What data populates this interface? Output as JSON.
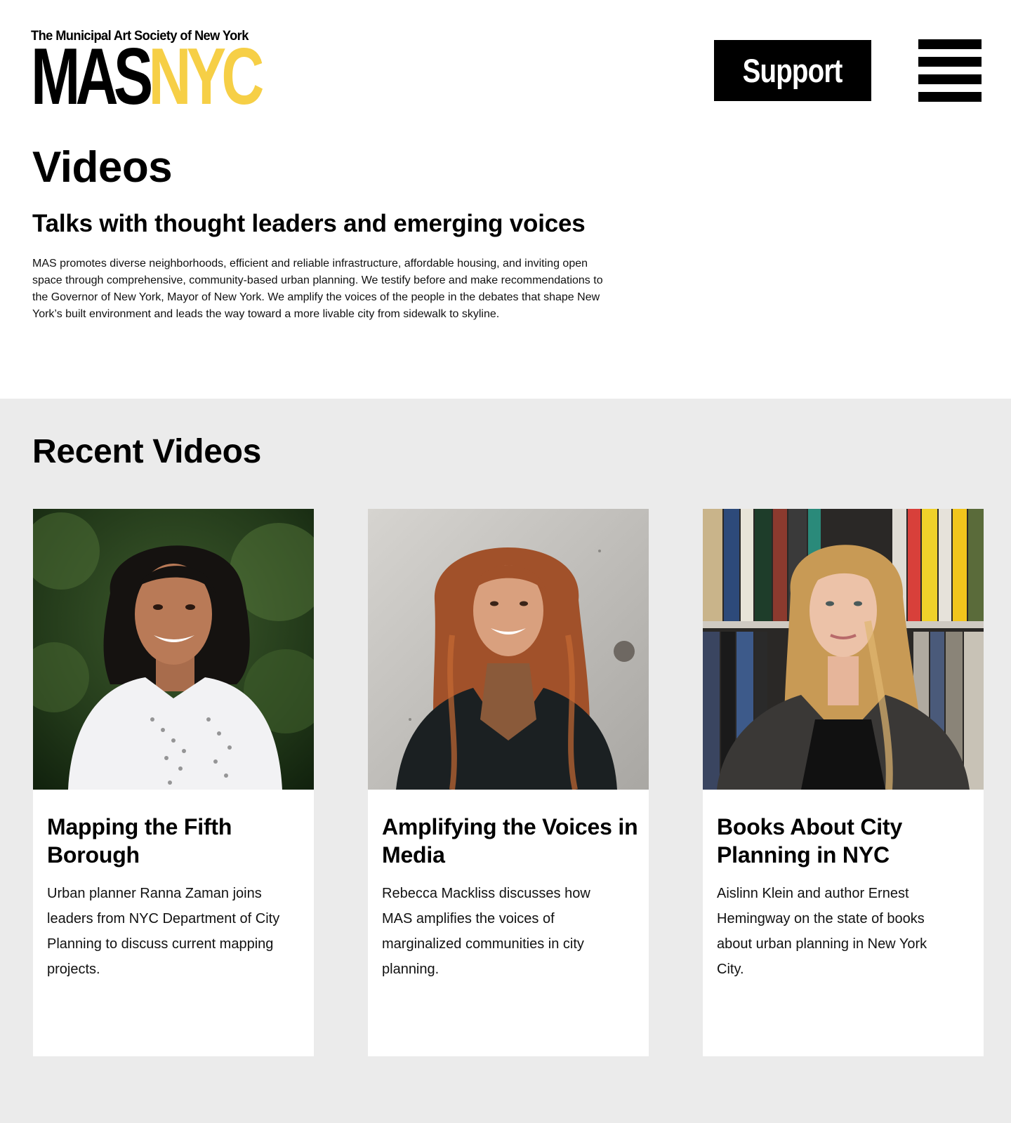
{
  "header": {
    "logo_subtitle": "The Municipal Art Society of New York",
    "logo_main_left": "MAS",
    "logo_main_right": "NYC",
    "support_label": "Support",
    "menu_icon": "hamburger-menu-icon"
  },
  "intro": {
    "title": "Videos",
    "subtitle": "Talks with thought leaders and emerging voices",
    "description": "MAS promotes diverse neighborhoods, efficient and reliable infrastructure, affordable housing, and inviting open space through comprehensive, community-based urban planning. We testify before and make recommendations to the Governor of New York, Mayor of New York. We amplify the voices of the people in the debates that shape New York’s built environment and leads the way toward a more livable city from sidewalk to skyline."
  },
  "recent": {
    "title": "Recent Videos",
    "cards": [
      {
        "title": "Mapping the Fifth Borough",
        "description": "Urban planner Ranna Zaman joins leaders from NYC Department of City Planning to discuss current mapping projects."
      },
      {
        "title": "Amplifying the Voices in Media",
        "description": "Rebecca Mackliss discusses how MAS amplifies the voices of marginalized communities in city planning."
      },
      {
        "title": "Books About City Planning in NYC",
        "description": "Aislinn Klein and author Ernest Hemingway on the state of books about urban planning in New York City."
      }
    ]
  },
  "colors": {
    "brand_yellow": "#f6cf46",
    "section_bg": "#ebebeb",
    "black": "#000000"
  }
}
